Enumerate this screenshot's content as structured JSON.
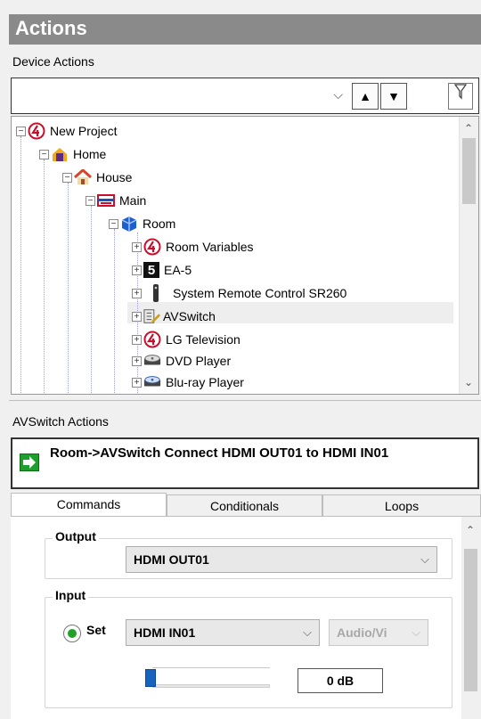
{
  "panel": {
    "title": "Actions"
  },
  "device_actions": {
    "label": "Device Actions",
    "search_value": "",
    "chevron": "⌵",
    "up_button": "▲",
    "down_button": "▼",
    "filter_icon": "filter-icon"
  },
  "tree": {
    "items": [
      {
        "label": "New Project",
        "icon": "project-logo-icon",
        "expander": "−"
      },
      {
        "label": "Home",
        "icon": "home-icon",
        "expander": "−"
      },
      {
        "label": "House",
        "icon": "house-icon",
        "expander": "−"
      },
      {
        "label": "Main",
        "icon": "floor-icon",
        "expander": "−"
      },
      {
        "label": "Room",
        "icon": "room-icon",
        "expander": "−"
      },
      {
        "label": "Room Variables",
        "icon": "variables-logo-icon",
        "expander": "+"
      },
      {
        "label": "EA-5",
        "icon": "controller-icon",
        "expander": "+",
        "badge": "5"
      },
      {
        "label": "System Remote Control SR260",
        "icon": "remote-icon",
        "expander": "+"
      },
      {
        "label": "AVSwitch",
        "icon": "avswitch-icon",
        "expander": "+"
      },
      {
        "label": "LG Television",
        "icon": "tv-logo-icon",
        "expander": "+"
      },
      {
        "label": "DVD Player",
        "icon": "dvd-icon",
        "expander": "+"
      },
      {
        "label": "Blu-ray Player",
        "icon": "bluray-icon",
        "expander": "+"
      }
    ]
  },
  "avswitch_actions": {
    "label": "AVSwitch Actions",
    "action_text": "Room->AVSwitch Connect HDMI OUT01 to HDMI IN01"
  },
  "tabs": [
    {
      "label": "Commands",
      "active": true
    },
    {
      "label": "Conditionals",
      "active": false
    },
    {
      "label": "Loops",
      "active": false
    }
  ],
  "commands": {
    "output": {
      "title": "Output",
      "value": "HDMI OUT01"
    },
    "input": {
      "title": "Input",
      "set_label": "Set",
      "value": "HDMI IN01",
      "mode": "Audio/Vi",
      "level": "0 dB"
    }
  },
  "colors": {
    "title_bar": "#8a8a8a",
    "accent_green": "#1e9e2a",
    "slider_blue": "#1565c0"
  }
}
